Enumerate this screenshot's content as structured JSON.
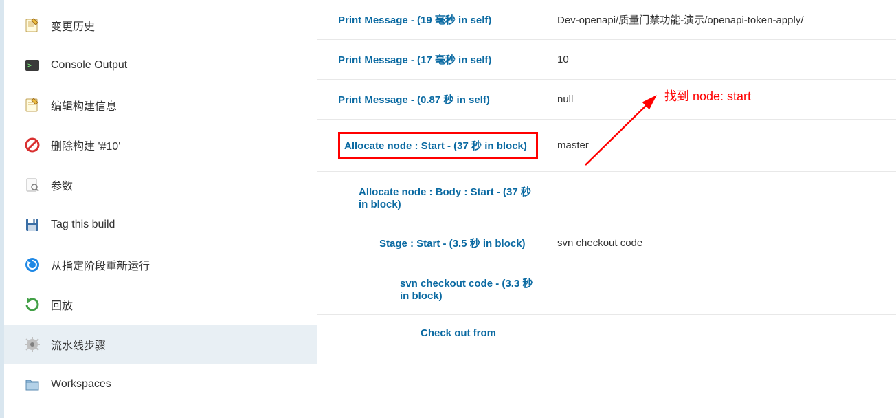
{
  "sidebar": {
    "items": [
      {
        "label": "变更历史"
      },
      {
        "label": "Console Output"
      },
      {
        "label": "编辑构建信息"
      },
      {
        "label": "删除构建 '#10'"
      },
      {
        "label": "参数"
      },
      {
        "label": "Tag this build"
      },
      {
        "label": "从指定阶段重新运行"
      },
      {
        "label": "回放"
      },
      {
        "label": "流水线步骤"
      },
      {
        "label": "Workspaces"
      }
    ]
  },
  "steps": [
    {
      "indent": 0,
      "label": "Print Message - (19 毫秒 in self)",
      "arg": "Dev-openapi/质量门禁功能-演示/openapi-token-apply/"
    },
    {
      "indent": 0,
      "label": "Print Message - (17 毫秒 in self)",
      "arg": "10"
    },
    {
      "indent": 0,
      "label": "Print Message - (0.87 秒 in self)",
      "arg": "null"
    },
    {
      "indent": 0,
      "label": "Allocate node : Start - (37 秒 in block)",
      "arg": "master",
      "boxed": true
    },
    {
      "indent": 1,
      "label": "Allocate node : Body : Start - (37 秒 in block)",
      "arg": ""
    },
    {
      "indent": 2,
      "label": "Stage : Start - (3.5 秒 in block)",
      "arg": "svn checkout code"
    },
    {
      "indent": 3,
      "label": "svn checkout code - (3.3 秒 in block)",
      "arg": ""
    },
    {
      "indent": 4,
      "label": "Check out from",
      "arg": ""
    }
  ],
  "annotation": {
    "text": "找到 node: start"
  }
}
